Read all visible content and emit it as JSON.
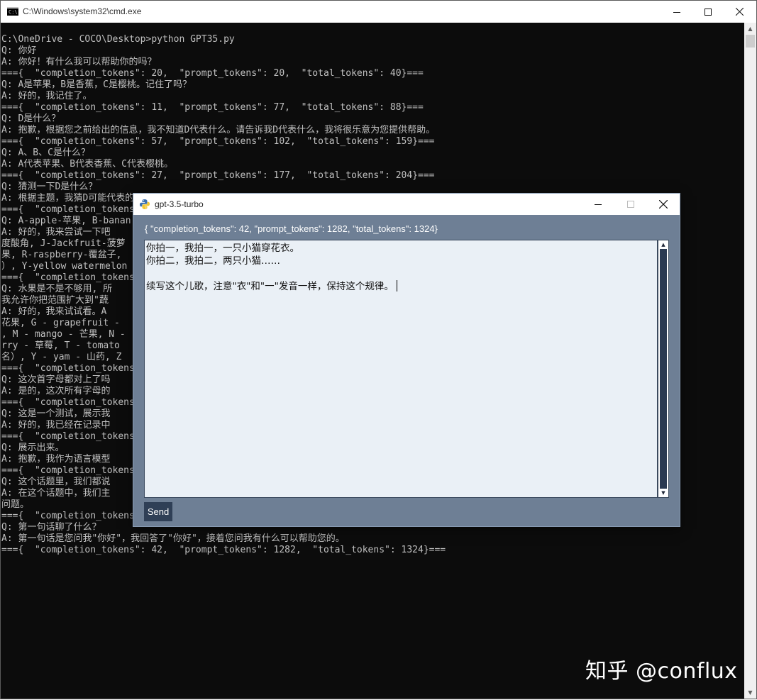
{
  "cmd": {
    "title": "C:\\Windows\\system32\\cmd.exe",
    "lines": [
      "C:\\OneDrive - COCO\\Desktop>python GPT35.py",
      "Q: 你好",
      "A: 你好！有什么我可以帮助你的吗？",
      "==={  \"completion_tokens\": 20,  \"prompt_tokens\": 20,  \"total_tokens\": 40}===",
      "Q: A是苹果，B是香蕉，C是樱桃。记住了吗？",
      "A: 好的，我记住了。",
      "==={  \"completion_tokens\": 11,  \"prompt_tokens\": 77,  \"total_tokens\": 88}===",
      "Q: D是什么？",
      "A: 抱歉，根据您之前给出的信息，我不知道D代表什么。请告诉我D代表什么，我将很乐意为您提供帮助。",
      "==={  \"completion_tokens\": 57,  \"prompt_tokens\": 102,  \"total_tokens\": 159}===",
      "Q: A、B、C是什么？",
      "A: A代表苹果、B代表香蕉、C代表樱桃。",
      "==={  \"completion_tokens\": 27,  \"prompt_tokens\": 177,  \"total_tokens\": 204}===",
      "Q: 猜测一下D是什么？",
      "A: 根据主题，我猜D可能代表的",
      "==={  \"completion_tokens",
      "Q: A-apple-苹果, B-banan",
      "A: 好的，我来尝试一下吧                                                           oseberry-印",
      "度酸角, J-Jackfruit-菠萝                                                         @-quiwi-奇异",
      "果, R-raspberry-覆盆子,                                                           瓜（中文名",
      "）, Y-yellow watermelon",
      "==={  \"completion_tokens",
      "Q: 水果是不是不够用, 所",
      "我允许你把范围扩大到\"蔬",
      "A: 好的，我来试试看。A                                                            ' - fig - 无",
      "花果, G - grapefruit -                                                            emon - 柠檬",
      ", M - mango - 芒果, N -                                                           S - strawbe",
      "rry - 草莓, T - tomato                                                            西瓜（中文",
      "名）, Y - yam - 山药, Z",
      "==={  \"completion_tokens",
      "Q: 这次首字母都对上了吗",
      "A: 是的，这次所有字母的",
      "==={  \"completion_tokens",
      "Q: 这是一个测试，展示我",
      "A: 好的，我已经在记录中",
      "==={  \"completion_tokens",
      "Q: 展示出来。",
      "A: 抱歉，我作为语言模型",
      "==={  \"completion_tokens",
      "Q: 这个话题里，我们都说",
      "A: 在这个话题中，我们主                                                           示对话历史的",
      "问题。",
      "==={  \"completion_tokens",
      "Q: 第一句话聊了什么？",
      "A: 第一句话是您问我\"你好\"，我回答了\"你好\"，接着您问我有什么可以帮助您的。",
      "==={  \"completion_tokens\": 42,  \"prompt_tokens\": 1282,  \"total_tokens\": 1324}==="
    ],
    "caption_buttons": {
      "minimize": "—",
      "maximize": "☐",
      "close": "✕"
    },
    "scroll": {
      "up": "▲",
      "down": "▼"
    }
  },
  "watermark": "知乎 @conflux",
  "gpt": {
    "title": "gpt-3.5-turbo",
    "token_info": "{ \"completion_tokens\": 42, \"prompt_tokens\": 1282, \"total_tokens\": 1324}",
    "input_text": "你拍一，我拍一，一只小猫穿花衣。\n你拍二，我拍二，两只小猫……\n\n续写这个儿歌，注意\"衣\"和\"一\"发音一样，保持这个规律。",
    "send_label": "Send",
    "scroll": {
      "up": "▲",
      "down": "▼"
    }
  },
  "colors": {
    "console_bg": "#0c0c0c",
    "console_text": "#c0c0c0",
    "gpt_panel": "#6e7f95",
    "chat_bg": "#eaf0f6",
    "send_bg": "#2f3f56"
  }
}
